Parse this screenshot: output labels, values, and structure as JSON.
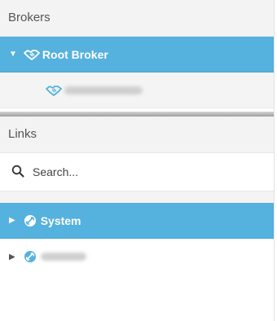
{
  "brokers": {
    "header": "Brokers",
    "root": {
      "label": "Root Broker",
      "expanded": true
    },
    "children": [
      {
        "label": ""
      }
    ]
  },
  "links": {
    "header": "Links",
    "search": {
      "placeholder": "Search...",
      "value": ""
    },
    "items": [
      {
        "label": "System",
        "selected": true
      },
      {
        "label": "",
        "selected": false
      }
    ]
  },
  "colors": {
    "selected": "#55b1de",
    "header_bg": "#f3f3f3",
    "icon_blue": "#55b1de"
  },
  "icons": {
    "broker": "handshake-icon",
    "link": "link-icon",
    "search": "search-icon"
  }
}
